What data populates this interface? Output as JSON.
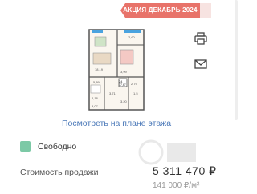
{
  "promo": {
    "label": "АКЦИЯ ДЕКАБРЬ 2024"
  },
  "actions": {
    "print": "printer-icon",
    "email": "mail-icon"
  },
  "plan": {
    "room_labels": [
      "18,19",
      "2,60",
      "3,99",
      "5,89",
      "2,79",
      "1,5",
      "4,18",
      "3,71",
      "3,20",
      "3,07"
    ],
    "apartment_number": "24",
    "apartment_area": "37,67"
  },
  "floor_link": "Посмотреть на плане этажа",
  "status": {
    "label": "Свободно",
    "color": "#7cc9a6"
  },
  "price": {
    "label": "Стоимость продажи",
    "value": "5 311 470 ₽",
    "per_m2": "141 000 ₽/м²"
  }
}
